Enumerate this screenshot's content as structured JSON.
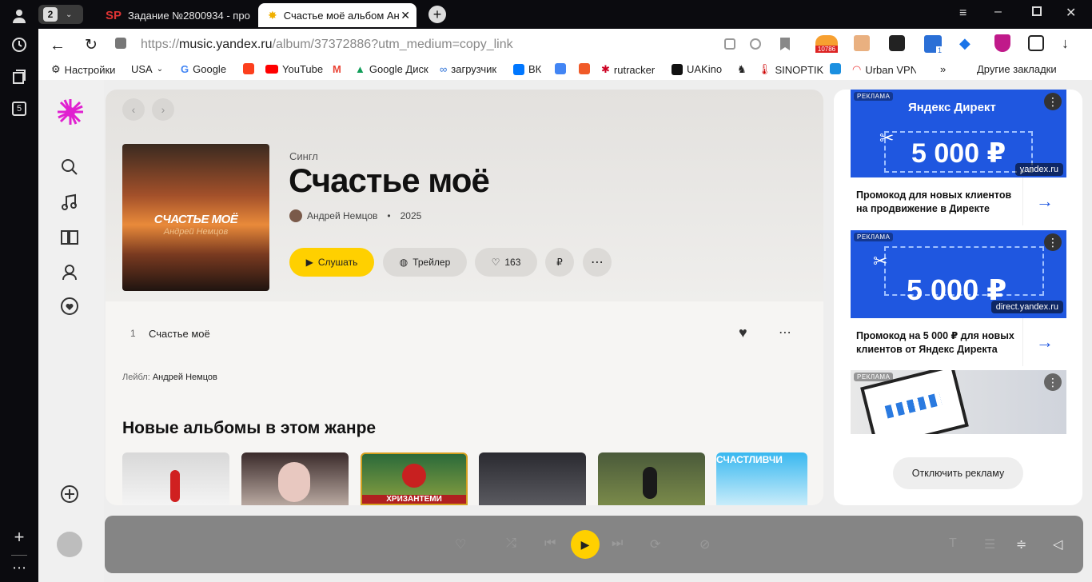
{
  "browser": {
    "tab_count": "2",
    "tabs": [
      {
        "icon": "SP",
        "title": "Задание №2800934 - про"
      },
      {
        "title": "Счастье моё альбом Ан"
      }
    ],
    "url_prefix": "https://",
    "url_domain": "music.yandex.ru",
    "url_path": "/album/37372886?utm_medium=copy_link",
    "ext_badge": "10786",
    "ext_badge2": "1",
    "bookmarks": [
      "Настройки",
      "USA",
      "Google",
      "YouTube",
      "",
      "Google Диск",
      "загрузчик",
      "ВК",
      "",
      "",
      "rutracker",
      "UAKino",
      "",
      "SINOPTIK",
      "",
      "Urban VPN P"
    ],
    "other_bookmarks": "Другие закладки",
    "rail_badge": "5"
  },
  "album": {
    "type": "Сингл",
    "title": "Счастье моё",
    "artist": "Андрей Немцов",
    "year": "2025",
    "cover_title": "СЧАСТЬЕ МОЁ",
    "cover_artist": "Андрей Немцов",
    "play_label": "Слушать",
    "trailer_label": "Трейлер",
    "likes": "163",
    "tracks": [
      {
        "num": "1",
        "title": "Счастье моё"
      }
    ],
    "label_prefix": "Лейбл:",
    "label_name": "Андрей Немцов",
    "section_title": "Новые альбомы в этом жанре",
    "cover5_text": "ХРИЗАНТЕМИ",
    "cover6_text": "СЧАСТЛИВЧИ"
  },
  "ads": {
    "badge": "РЕКЛАМА",
    "ad1_brand": "Яндекс Директ",
    "ad1_amount": "5 000 ₽",
    "ad1_domain": "yandex.ru",
    "ad1_text": "Промокод для новых клиентов на продвижение в Директе",
    "ad2_amount": "5 000 ₽",
    "ad2_domain": "direct.yandex.ru",
    "ad2_text": "Промокод на 5 000 ₽ для новых клиентов от Яндекс Директа",
    "disable_label": "Отключить рекламу"
  },
  "colors": {
    "accent": "#ffd000",
    "ad_blue": "#1f57e0",
    "logo": "#e020d0"
  }
}
